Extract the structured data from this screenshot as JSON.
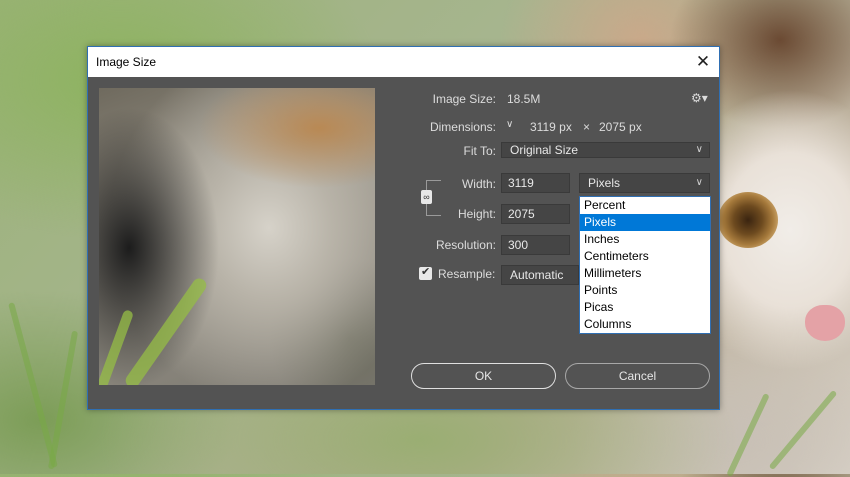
{
  "dialog": {
    "title": "Image Size",
    "close_glyph": "✕"
  },
  "info": {
    "image_size_label": "Image Size:",
    "image_size_value": "18.5M",
    "dimensions_label": "Dimensions:",
    "dimensions_width": "3119 px",
    "dimensions_times": "×",
    "dimensions_height": "2075 px",
    "settings_icon": "gear-icon"
  },
  "fit_to": {
    "label": "Fit To:",
    "value": "Original Size"
  },
  "width": {
    "label": "Width:",
    "value": "3119"
  },
  "height": {
    "label": "Height:",
    "value": "2075"
  },
  "resolution": {
    "label": "Resolution:",
    "value": "300"
  },
  "resample": {
    "label": "Resample:",
    "checked": true,
    "value": "Automatic"
  },
  "unit_select": {
    "value": "Pixels",
    "options": [
      "Percent",
      "Pixels",
      "Inches",
      "Centimeters",
      "Millimeters",
      "Points",
      "Picas",
      "Columns"
    ],
    "selected_index": 1
  },
  "buttons": {
    "ok": "OK",
    "cancel": "Cancel"
  },
  "colors": {
    "dialog_bg": "#535353",
    "accent": "#0078d7",
    "border": "#2f6fb3"
  }
}
